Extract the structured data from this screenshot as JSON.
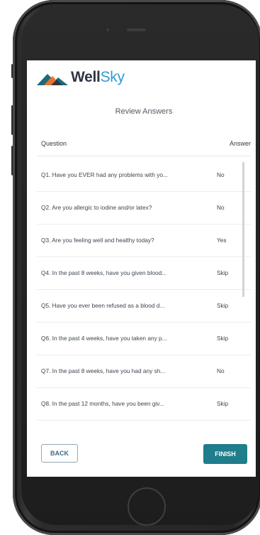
{
  "app": {
    "logo_word": "Well",
    "logo_word_accent": "Sky"
  },
  "screen": {
    "title": "Review Answers"
  },
  "table": {
    "headers": {
      "question": "Question",
      "answer": "Answer"
    },
    "rows": [
      {
        "question": "Q1.   Have you EVER had any problems with yo...",
        "answer": "No"
      },
      {
        "question": "Q2.   Are you allergic to iodine and/or latex?",
        "answer": "No"
      },
      {
        "question": "Q3.   Are you feeling well and healthy today?",
        "answer": "Yes"
      },
      {
        "question": "Q4.   In the past 8 weeks, have you given blood...",
        "answer": "Skip"
      },
      {
        "question": "Q5.   Have you ever been refused as a blood d...",
        "answer": "Skip"
      },
      {
        "question": "Q6.   In the past 4 weeks, have you taken any p...",
        "answer": "Skip"
      },
      {
        "question": "Q7.   In the past 8 weeks, have you had any sh...",
        "answer": "No"
      },
      {
        "question": "Q8.   In the past 12 months, have you been giv...",
        "answer": "Skip"
      }
    ]
  },
  "actions": {
    "back_label": "BACK",
    "finish_label": "FINISH"
  },
  "colors": {
    "accent": "#1f7d8c",
    "brand_dark": "#2f3541",
    "brand_blue": "#2e9bd6",
    "logo_orange": "#e8742c",
    "logo_teal": "#1d6a7a"
  },
  "icons": {
    "logo": "wellsky-mountain-icon",
    "home": "home-button-icon"
  }
}
